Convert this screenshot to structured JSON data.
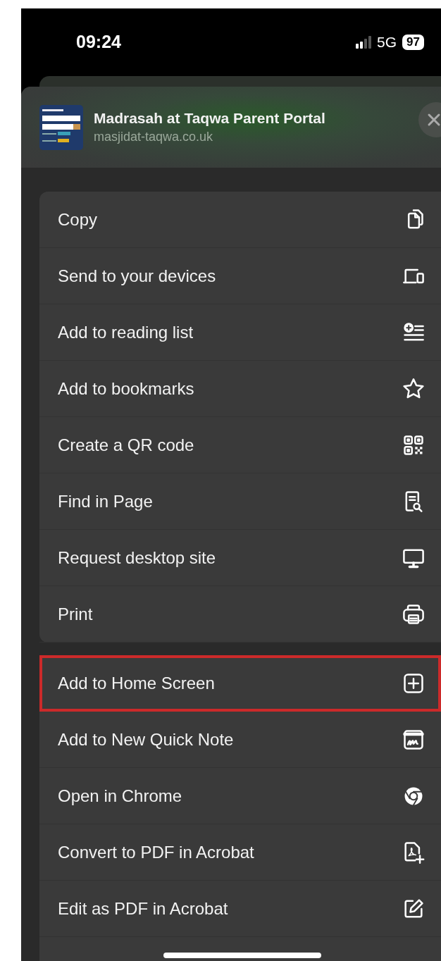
{
  "status_bar": {
    "time": "09:24",
    "network": "5G",
    "battery": "97"
  },
  "site": {
    "title": "Madrasah at Taqwa Parent Portal",
    "url": "masjidat-taqwa.co.uk"
  },
  "groups": [
    {
      "items": [
        {
          "label": "Copy",
          "highlighted": false
        },
        {
          "label": "Send to your devices",
          "highlighted": false
        },
        {
          "label": "Add to reading list",
          "highlighted": false
        },
        {
          "label": "Add to bookmarks",
          "highlighted": false
        },
        {
          "label": "Create a QR code",
          "highlighted": false
        },
        {
          "label": "Find in Page",
          "highlighted": false
        },
        {
          "label": "Request desktop site",
          "highlighted": false
        },
        {
          "label": "Print",
          "highlighted": false
        }
      ]
    },
    {
      "items": [
        {
          "label": "Add to Home Screen",
          "highlighted": true
        },
        {
          "label": "Add to New Quick Note",
          "highlighted": false
        },
        {
          "label": "Open in Chrome",
          "highlighted": false
        },
        {
          "label": "Convert to PDF in Acrobat",
          "highlighted": false
        },
        {
          "label": "Edit as PDF in Acrobat",
          "highlighted": false
        }
      ]
    }
  ]
}
